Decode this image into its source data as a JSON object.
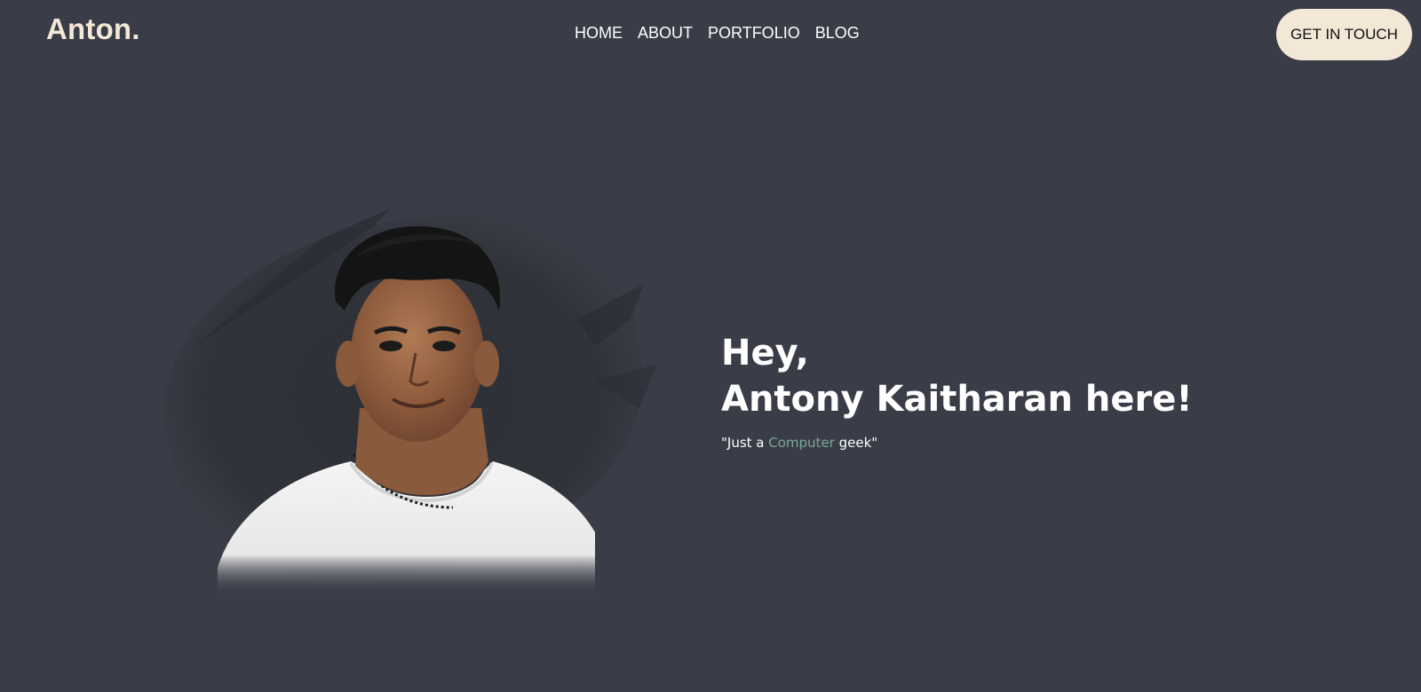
{
  "header": {
    "brand": "Anton.",
    "nav": [
      "HOME",
      "ABOUT",
      "PORTFOLIO",
      "BLOG"
    ],
    "cta": "GET IN TOUCH"
  },
  "hero": {
    "greeting": "Hey,",
    "name_line": "Antony Kaitharan here!",
    "tagline": {
      "prefix": "\"Just a ",
      "highlight": "Computer",
      "suffix": " geek\""
    }
  },
  "colors": {
    "background": "#3a3d47",
    "brand": "#f3e7d6",
    "accent": "#7aa79a",
    "text": "#ffffff",
    "cta_bg": "#f3e7d6"
  }
}
